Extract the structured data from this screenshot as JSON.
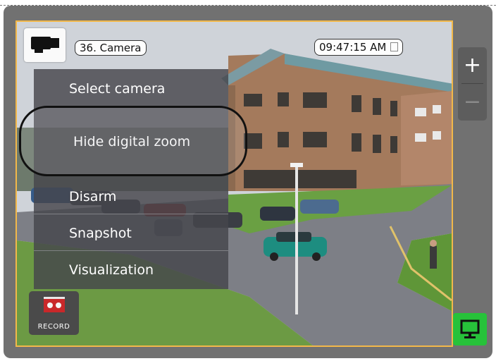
{
  "camera": {
    "name": "36. Camera",
    "time": "09:47:15 AM"
  },
  "context_menu": {
    "items": [
      {
        "label": "Select camera"
      },
      {
        "label": "Hide digital zoom"
      },
      {
        "label": "Disarm"
      },
      {
        "label": "Snapshot"
      },
      {
        "label": "Visualization"
      }
    ]
  },
  "zoom": {
    "in_label": "+",
    "out_label": "−"
  },
  "record": {
    "label": "RECORD"
  },
  "icons": {
    "camera": "camera-icon",
    "time_menu": "document-icon",
    "record": "record-icon",
    "monitor": "monitor-icon"
  },
  "colors": {
    "selection_border": "#f2b84a",
    "menu_bg": "#46464c",
    "monitor_button": "#27c23a",
    "record_red": "#c9282a"
  }
}
